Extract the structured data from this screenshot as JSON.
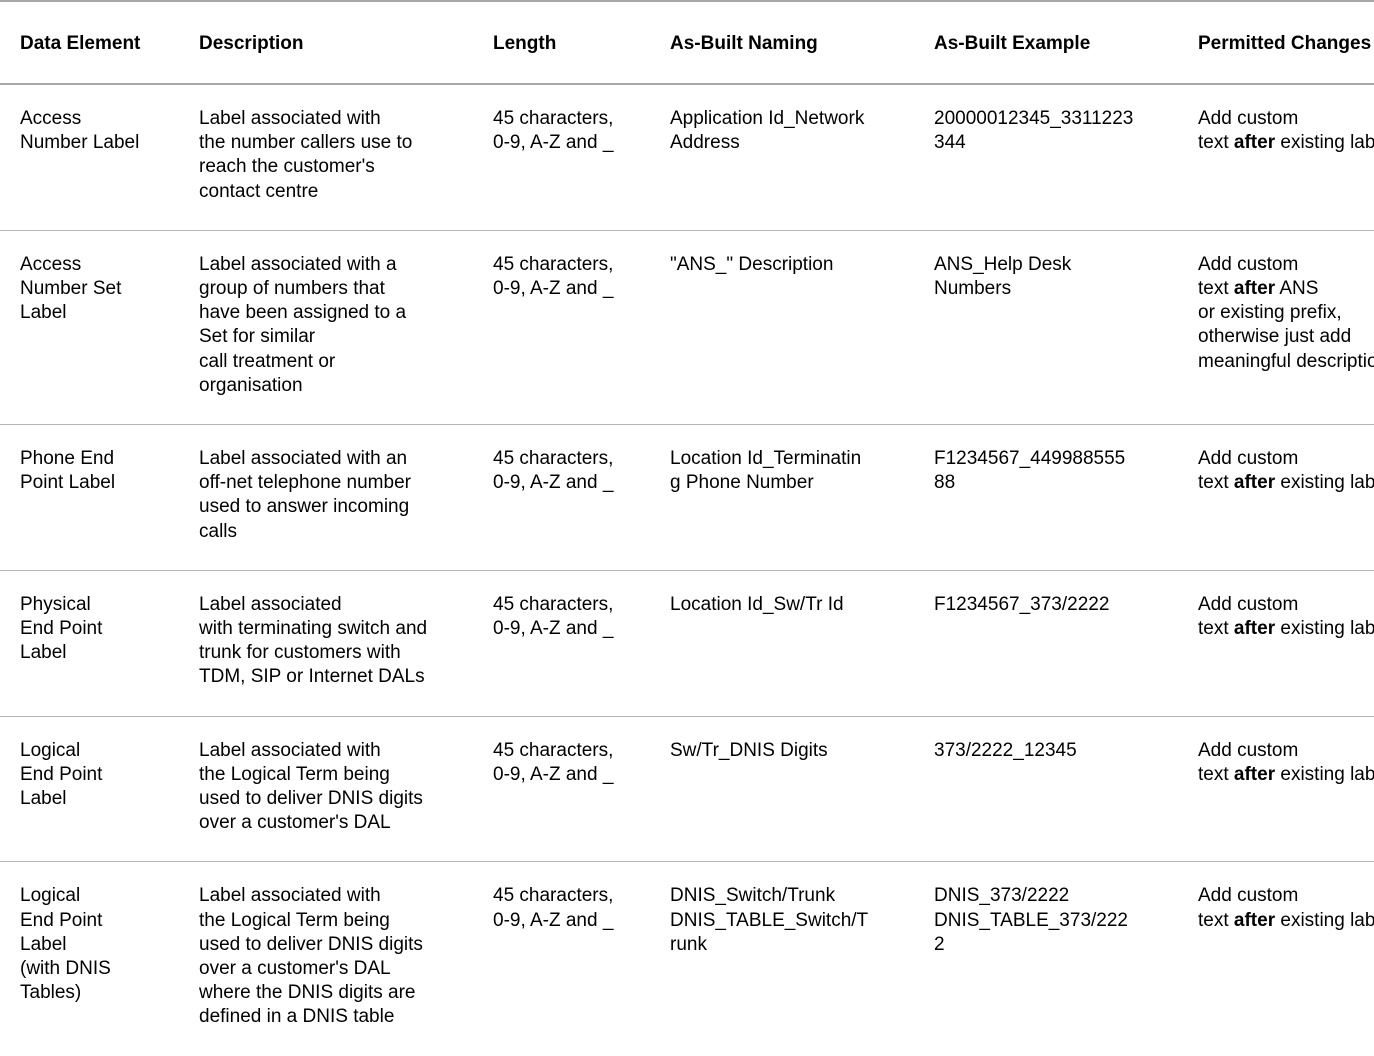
{
  "table": {
    "columns": [
      {
        "key": "element",
        "label": "Data Element"
      },
      {
        "key": "description",
        "label": "Description"
      },
      {
        "key": "length",
        "label": "Length"
      },
      {
        "key": "naming",
        "label": "As-Built Naming"
      },
      {
        "key": "example",
        "label": "As-Built Example"
      },
      {
        "key": "permitted",
        "label": "Permitted Changes"
      }
    ],
    "rows": [
      {
        "element": "Access\nNumber Label",
        "description": "Label associated with\nthe number callers use to\nreach the customer's\ncontact centre",
        "length": "45 characters,\n0-9, A-Z and _",
        "naming": "Application Id_Network\nAddress",
        "example": "20000012345_3311223\n344",
        "permitted_pre": "Add custom\ntext ",
        "permitted_bold": "after",
        "permitted_post": " existing label"
      },
      {
        "element": "Access\nNumber Set\nLabel",
        "description": "Label associated with a\ngroup of numbers that\nhave been assigned to a\nSet for similar\ncall treatment or\norganisation",
        "length": "45 characters,\n0-9, A-Z and _",
        "naming": "\"ANS_\" Description",
        "example": "ANS_Help Desk\nNumbers",
        "permitted_pre": "Add custom\ntext ",
        "permitted_bold": "after",
        "permitted_post": " ANS\nor existing prefix,\notherwise just add\nmeaningful description"
      },
      {
        "element": "Phone End\nPoint Label",
        "description": "Label associated with an\noff-net telephone number\nused to answer incoming\ncalls",
        "length": "45 characters,\n0-9, A-Z and _",
        "naming": "Location Id_Terminatin\ng Phone Number",
        "example": "F1234567_449988555\n88",
        "permitted_pre": "Add custom\ntext ",
        "permitted_bold": "after",
        "permitted_post": " existing label"
      },
      {
        "element": "Physical\nEnd Point\nLabel",
        "description": "Label associated\nwith terminating switch and\ntrunk for customers with\nTDM, SIP or Internet DALs",
        "length": "45 characters,\n0-9, A-Z and _",
        "naming": "Location Id_Sw/Tr Id",
        "example": "F1234567_373/2222",
        "permitted_pre": "Add custom\ntext ",
        "permitted_bold": "after",
        "permitted_post": " existing label"
      },
      {
        "element": "Logical\nEnd Point\nLabel",
        "description": "Label associated with\nthe Logical Term being\nused to deliver DNIS digits\nover a customer's DAL",
        "length": "45 characters,\n0-9, A-Z and _",
        "naming": "Sw/Tr_DNIS Digits",
        "example": "373/2222_12345",
        "permitted_pre": "Add custom\ntext ",
        "permitted_bold": "after",
        "permitted_post": " existing label"
      },
      {
        "element": "Logical\nEnd Point\nLabel\n(with DNIS\nTables)",
        "description": "Label associated with\nthe Logical Term being\nused to deliver DNIS digits\nover a customer's DAL\nwhere the DNIS digits are\ndefined in a DNIS table",
        "length": "45 characters,\n0-9, A-Z and _",
        "naming": "DNIS_Switch/Trunk\nDNIS_TABLE_Switch/T\nrunk",
        "example": "DNIS_373/2222\nDNIS_TABLE_373/222\n2",
        "permitted_pre": "Add custom\ntext ",
        "permitted_bold": "after",
        "permitted_post": " existing label"
      }
    ]
  },
  "colors": {
    "text": "#000000",
    "rule": "#b5b5b5",
    "header_rule": "#a8a8a8",
    "background": "#ffffff"
  }
}
